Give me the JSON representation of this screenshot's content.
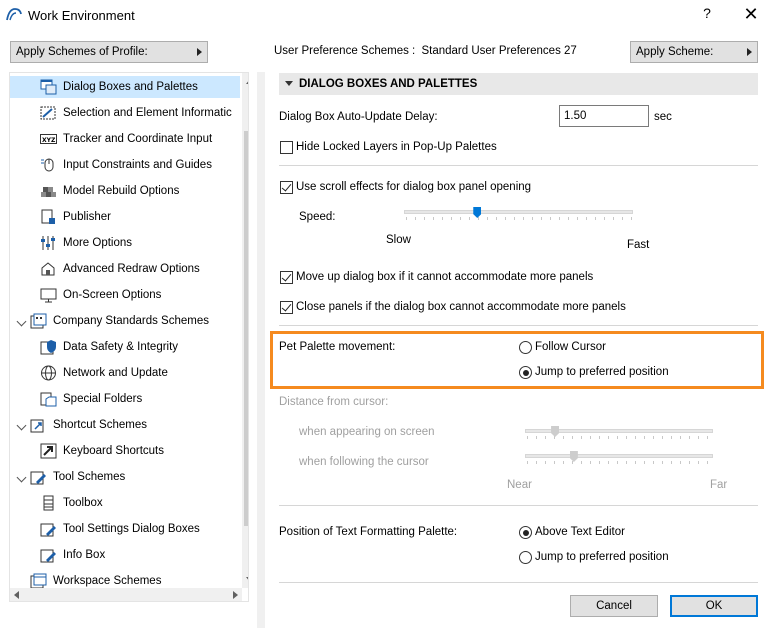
{
  "window": {
    "title": "Work Environment",
    "help_label": "?",
    "close_label": "✕"
  },
  "profile_button": {
    "label": "Apply Schemes of Profile:"
  },
  "scheme_info": {
    "label": "User Preference Schemes :",
    "value": "Standard User Preferences 27"
  },
  "apply_scheme_button": {
    "label": "Apply Scheme:"
  },
  "tree": {
    "items": [
      {
        "label": "Dialog Boxes and Palettes",
        "icon": "dialog-palette-icon",
        "selected": true
      },
      {
        "label": "Selection and Element Informatic",
        "icon": "selection-icon"
      },
      {
        "label": "Tracker and Coordinate Input",
        "icon": "xyz-tracker-icon"
      },
      {
        "label": "Input Constraints and Guides",
        "icon": "mouse-constraint-icon"
      },
      {
        "label": "Model Rebuild Options",
        "icon": "rebuild-icon"
      },
      {
        "label": "Publisher",
        "icon": "publisher-icon"
      },
      {
        "label": "More Options",
        "icon": "sliders-icon"
      },
      {
        "label": "Advanced Redraw Options",
        "icon": "redraw-icon"
      },
      {
        "label": "On-Screen Options",
        "icon": "monitor-icon"
      },
      {
        "label": "Company Standards Schemes",
        "icon": "company-schemes-icon",
        "group": true
      },
      {
        "label": "Data Safety & Integrity",
        "icon": "data-safety-icon"
      },
      {
        "label": "Network and Update",
        "icon": "globe-icon"
      },
      {
        "label": "Special Folders",
        "icon": "folders-icon"
      },
      {
        "label": "Shortcut Schemes",
        "icon": "shortcut-schemes-icon",
        "group": true
      },
      {
        "label": "Keyboard Shortcuts",
        "icon": "keyboard-shortcut-icon"
      },
      {
        "label": "Tool Schemes",
        "icon": "tool-schemes-icon",
        "group": true
      },
      {
        "label": "Toolbox",
        "icon": "toolbox-icon"
      },
      {
        "label": "Tool Settings Dialog Boxes",
        "icon": "tool-settings-icon"
      },
      {
        "label": "Info Box",
        "icon": "info-box-icon"
      },
      {
        "label": "Workspace Schemes",
        "icon": "workspace-schemes-icon",
        "group": true
      }
    ]
  },
  "panel": {
    "header": "DIALOG BOXES AND PALETTES",
    "auto_update": {
      "label": "Dialog Box Auto-Update Delay:",
      "value": "1.50",
      "unit": "sec"
    },
    "hide_locked": {
      "label": "Hide Locked Layers in Pop-Up Palettes",
      "checked": false
    },
    "scroll_effects": {
      "label": "Use scroll effects for dialog box panel opening",
      "checked": true
    },
    "speed": {
      "label": "Speed:",
      "min_label": "Slow",
      "max_label": "Fast",
      "value": 0.32
    },
    "move_up": {
      "label": "Move up dialog box if it cannot accommodate more panels",
      "checked": true
    },
    "close_panels": {
      "label": "Close panels if the dialog box cannot accommodate more panels",
      "checked": true
    },
    "pet_palette": {
      "label": "Pet Palette movement:",
      "options": [
        "Follow Cursor",
        "Jump to preferred position"
      ],
      "selected": "Jump to preferred position",
      "highlight_color": "#f58a1f"
    },
    "distance": {
      "label": "Distance from cursor:",
      "appearing_label": "when appearing on screen",
      "appearing_value": 0.16,
      "following_label": "when following the cursor",
      "following_value": 0.26,
      "near_label": "Near",
      "far_label": "Far"
    },
    "text_palette": {
      "label": "Position of Text Formatting Palette:",
      "options": [
        "Above Text Editor",
        "Jump to preferred position"
      ],
      "selected": "Above Text Editor"
    }
  },
  "footer": {
    "cancel_label": "Cancel",
    "ok_label": "OK"
  },
  "colors": {
    "selection": "#cce8ff",
    "primary_button_border": "#0078d7",
    "slider_thumb": "#0078d7"
  }
}
